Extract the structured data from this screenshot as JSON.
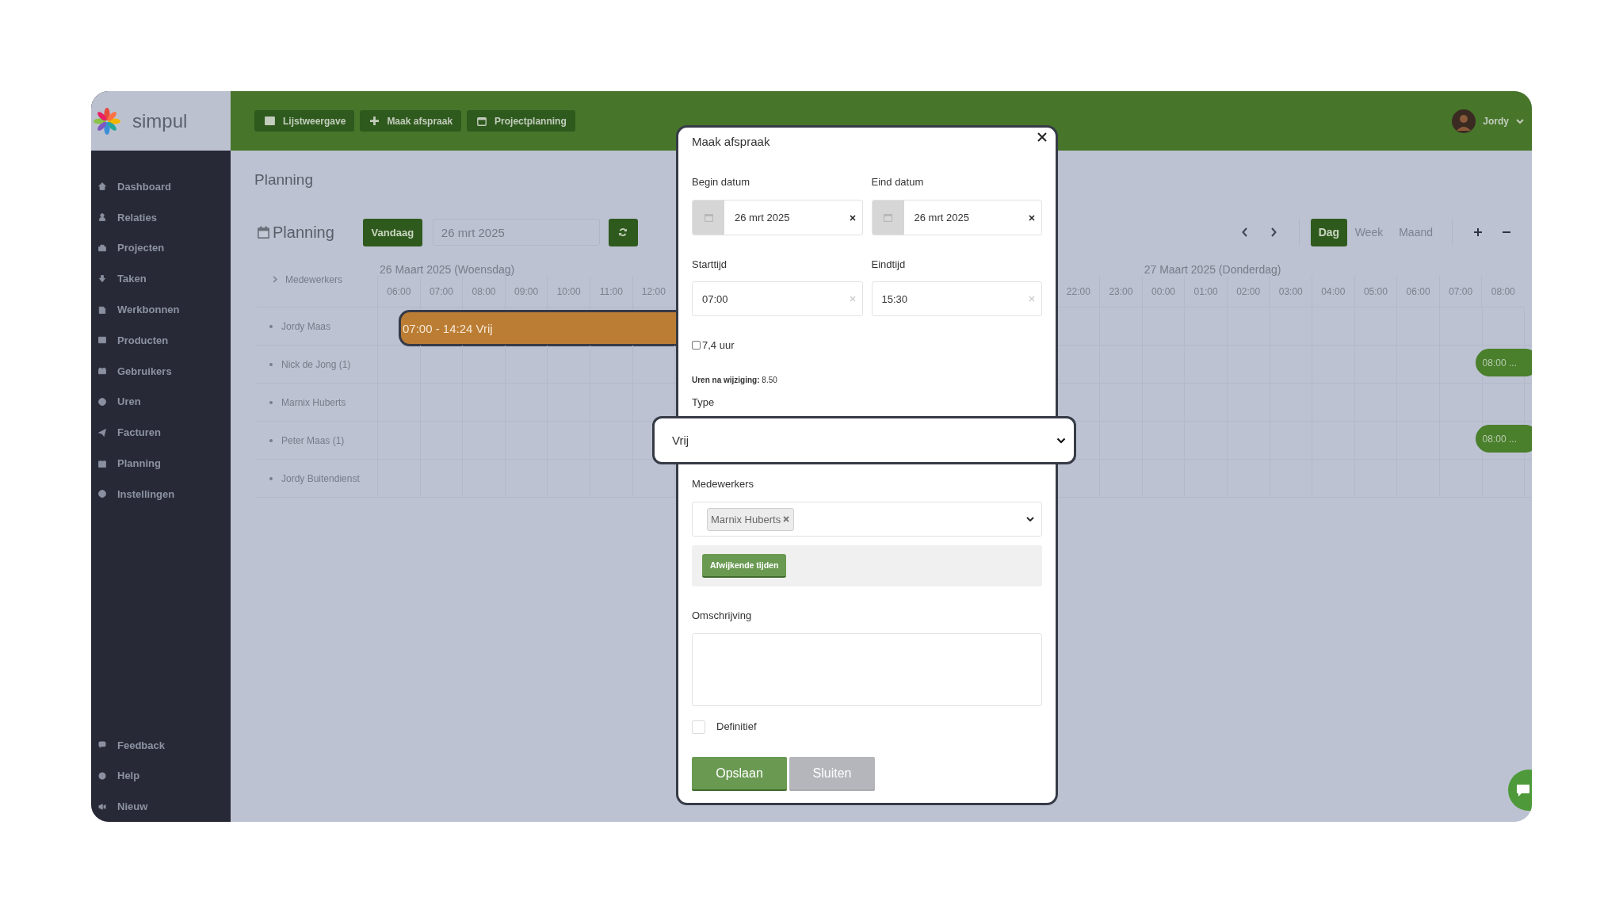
{
  "app": {
    "logo_text": "simpul"
  },
  "sidebar": {
    "items": [
      {
        "label": "Dashboard"
      },
      {
        "label": "Relaties"
      },
      {
        "label": "Projecten"
      },
      {
        "label": "Taken"
      },
      {
        "label": "Werkbonnen"
      },
      {
        "label": "Producten"
      },
      {
        "label": "Gebruikers"
      },
      {
        "label": "Uren"
      },
      {
        "label": "Facturen"
      },
      {
        "label": "Planning"
      },
      {
        "label": "Instellingen"
      }
    ],
    "bottom_items": [
      {
        "label": "Feedback"
      },
      {
        "label": "Help"
      },
      {
        "label": "Nieuw"
      }
    ]
  },
  "topbar": {
    "buttons": [
      {
        "label": "Lijstweergave"
      },
      {
        "label": "Maak afspraak"
      },
      {
        "label": "Projectplanning"
      }
    ],
    "user": {
      "name": "Jordy"
    }
  },
  "page": {
    "title": "Planning"
  },
  "toolbar": {
    "title": "Planning",
    "today_button": "Vandaag",
    "date": "26 mrt 2025",
    "views": [
      {
        "label": "Dag",
        "selected": true
      },
      {
        "label": "Week",
        "selected": false
      },
      {
        "label": "Maand",
        "selected": false
      }
    ]
  },
  "timeline": {
    "column_header": "Medewerkers",
    "day_1": {
      "label": "26 Maart 2025 (Woensdag)",
      "hours": [
        "06:00",
        "07:00",
        "08:00",
        "09:00",
        "10:00",
        "11:00",
        "12:00"
      ]
    },
    "late_hours": [
      "22:00",
      "23:00"
    ],
    "day_2": {
      "label": "27 Maart 2025 (Donderdag)",
      "hours": [
        "00:00",
        "01:00",
        "02:00",
        "03:00",
        "04:00",
        "05:00",
        "06:00",
        "07:00",
        "08:00"
      ]
    },
    "rows": [
      {
        "name": "Jordy Maas",
        "events": [
          {
            "text": "07:00 - 14:24 Vrij",
            "kind": "current",
            "color": "#bb7d33",
            "selected": true
          }
        ]
      },
      {
        "name": "Nick de Jong (1)",
        "events": [
          {
            "text": "08:00 ...",
            "kind": "next",
            "color": "#4a7f2c",
            "selected": false
          }
        ]
      },
      {
        "name": "Marnix Huberts",
        "events": []
      },
      {
        "name": "Peter Maas (1)",
        "events": [
          {
            "text": "08:00 ...",
            "kind": "next",
            "color": "#4a7f2c",
            "selected": false
          }
        ]
      },
      {
        "name": "Jordy Buitendienst",
        "events": []
      }
    ]
  },
  "modal": {
    "title": "Maak afspraak",
    "begin_date": {
      "label": "Begin datum",
      "value": "26 mrt 2025"
    },
    "end_date": {
      "label": "Eind datum",
      "value": "26 mrt 2025"
    },
    "start_time": {
      "label": "Starttijd",
      "value": "07:00"
    },
    "end_time": {
      "label": "Eindtijd",
      "value": "15:30"
    },
    "hours_checkbox": {
      "label": "7,4 uur",
      "checked": false
    },
    "hours_after_change": "**Uren na wijziging:** 8.50",
    "type": {
      "label": "Type",
      "value": "Vrij"
    },
    "employees": {
      "label": "Medewerkers",
      "tags": [
        "Marnix Huberts"
      ]
    },
    "deviating_times_button": "Afwijkende tijden",
    "description": {
      "label": "Omschrijving"
    },
    "final_checkbox": {
      "label": "Definitief",
      "checked": false
    },
    "buttons": [
      {
        "label": "Opslaan",
        "kind": "primary"
      },
      {
        "label": "Sluiten",
        "kind": "secondary"
      }
    ]
  }
}
